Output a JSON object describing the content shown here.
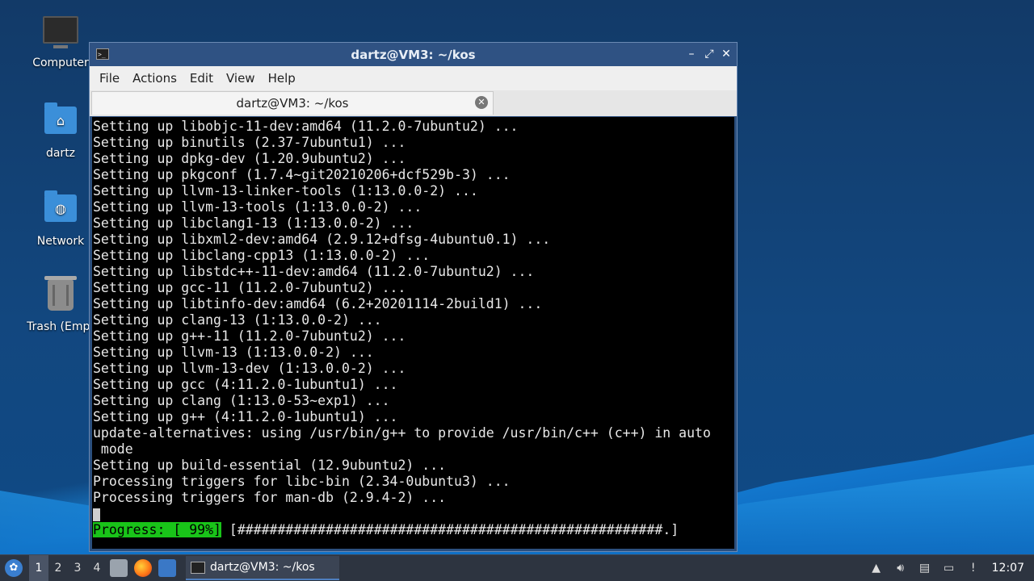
{
  "desktop": {
    "icons": [
      {
        "label": "Computer",
        "icon": "computer-icon"
      },
      {
        "label": "dartz",
        "icon": "home-folder-icon"
      },
      {
        "label": "Network",
        "icon": "network-folder-icon"
      },
      {
        "label": "Trash (Empt",
        "icon": "trash-icon"
      }
    ]
  },
  "window": {
    "title": "dartz@VM3: ~/kos",
    "buttons": {
      "minimize": "–",
      "maximize": "⤢",
      "close": "✕"
    },
    "menu": [
      "File",
      "Actions",
      "Edit",
      "View",
      "Help"
    ],
    "tab": {
      "label": "dartz@VM3: ~/kos",
      "close": "✕"
    }
  },
  "terminal": {
    "lines": [
      "Setting up libobjc-11-dev:amd64 (11.2.0-7ubuntu2) ...",
      "Setting up binutils (2.37-7ubuntu1) ...",
      "Setting up dpkg-dev (1.20.9ubuntu2) ...",
      "Setting up pkgconf (1.7.4~git20210206+dcf529b-3) ...",
      "Setting up llvm-13-linker-tools (1:13.0.0-2) ...",
      "Setting up llvm-13-tools (1:13.0.0-2) ...",
      "Setting up libclang1-13 (1:13.0.0-2) ...",
      "Setting up libxml2-dev:amd64 (2.9.12+dfsg-4ubuntu0.1) ...",
      "Setting up libclang-cpp13 (1:13.0.0-2) ...",
      "Setting up libstdc++-11-dev:amd64 (11.2.0-7ubuntu2) ...",
      "Setting up gcc-11 (11.2.0-7ubuntu2) ...",
      "Setting up libtinfo-dev:amd64 (6.2+20201114-2build1) ...",
      "Setting up clang-13 (1:13.0.0-2) ...",
      "Setting up g++-11 (11.2.0-7ubuntu2) ...",
      "Setting up llvm-13 (1:13.0.0-2) ...",
      "Setting up llvm-13-dev (1:13.0.0-2) ...",
      "Setting up gcc (4:11.2.0-1ubuntu1) ...",
      "Setting up clang (1:13.0-53~exp1) ...",
      "Setting up g++ (4:11.2.0-1ubuntu1) ...",
      "update-alternatives: using /usr/bin/g++ to provide /usr/bin/c++ (c++) in auto",
      " mode",
      "Setting up build-essential (12.9ubuntu2) ...",
      "Processing triggers for libc-bin (2.34-0ubuntu3) ...",
      "Processing triggers for man-db (2.9.4-2) ..."
    ],
    "progress_label": "Progress: [ 99%]",
    "progress_bar": " [#####################################################.]"
  },
  "taskbar": {
    "workspaces": [
      "1",
      "2",
      "3",
      "4"
    ],
    "active_workspace": "1",
    "task_label": "dartz@VM3: ~/kos",
    "clock": "12:07"
  }
}
